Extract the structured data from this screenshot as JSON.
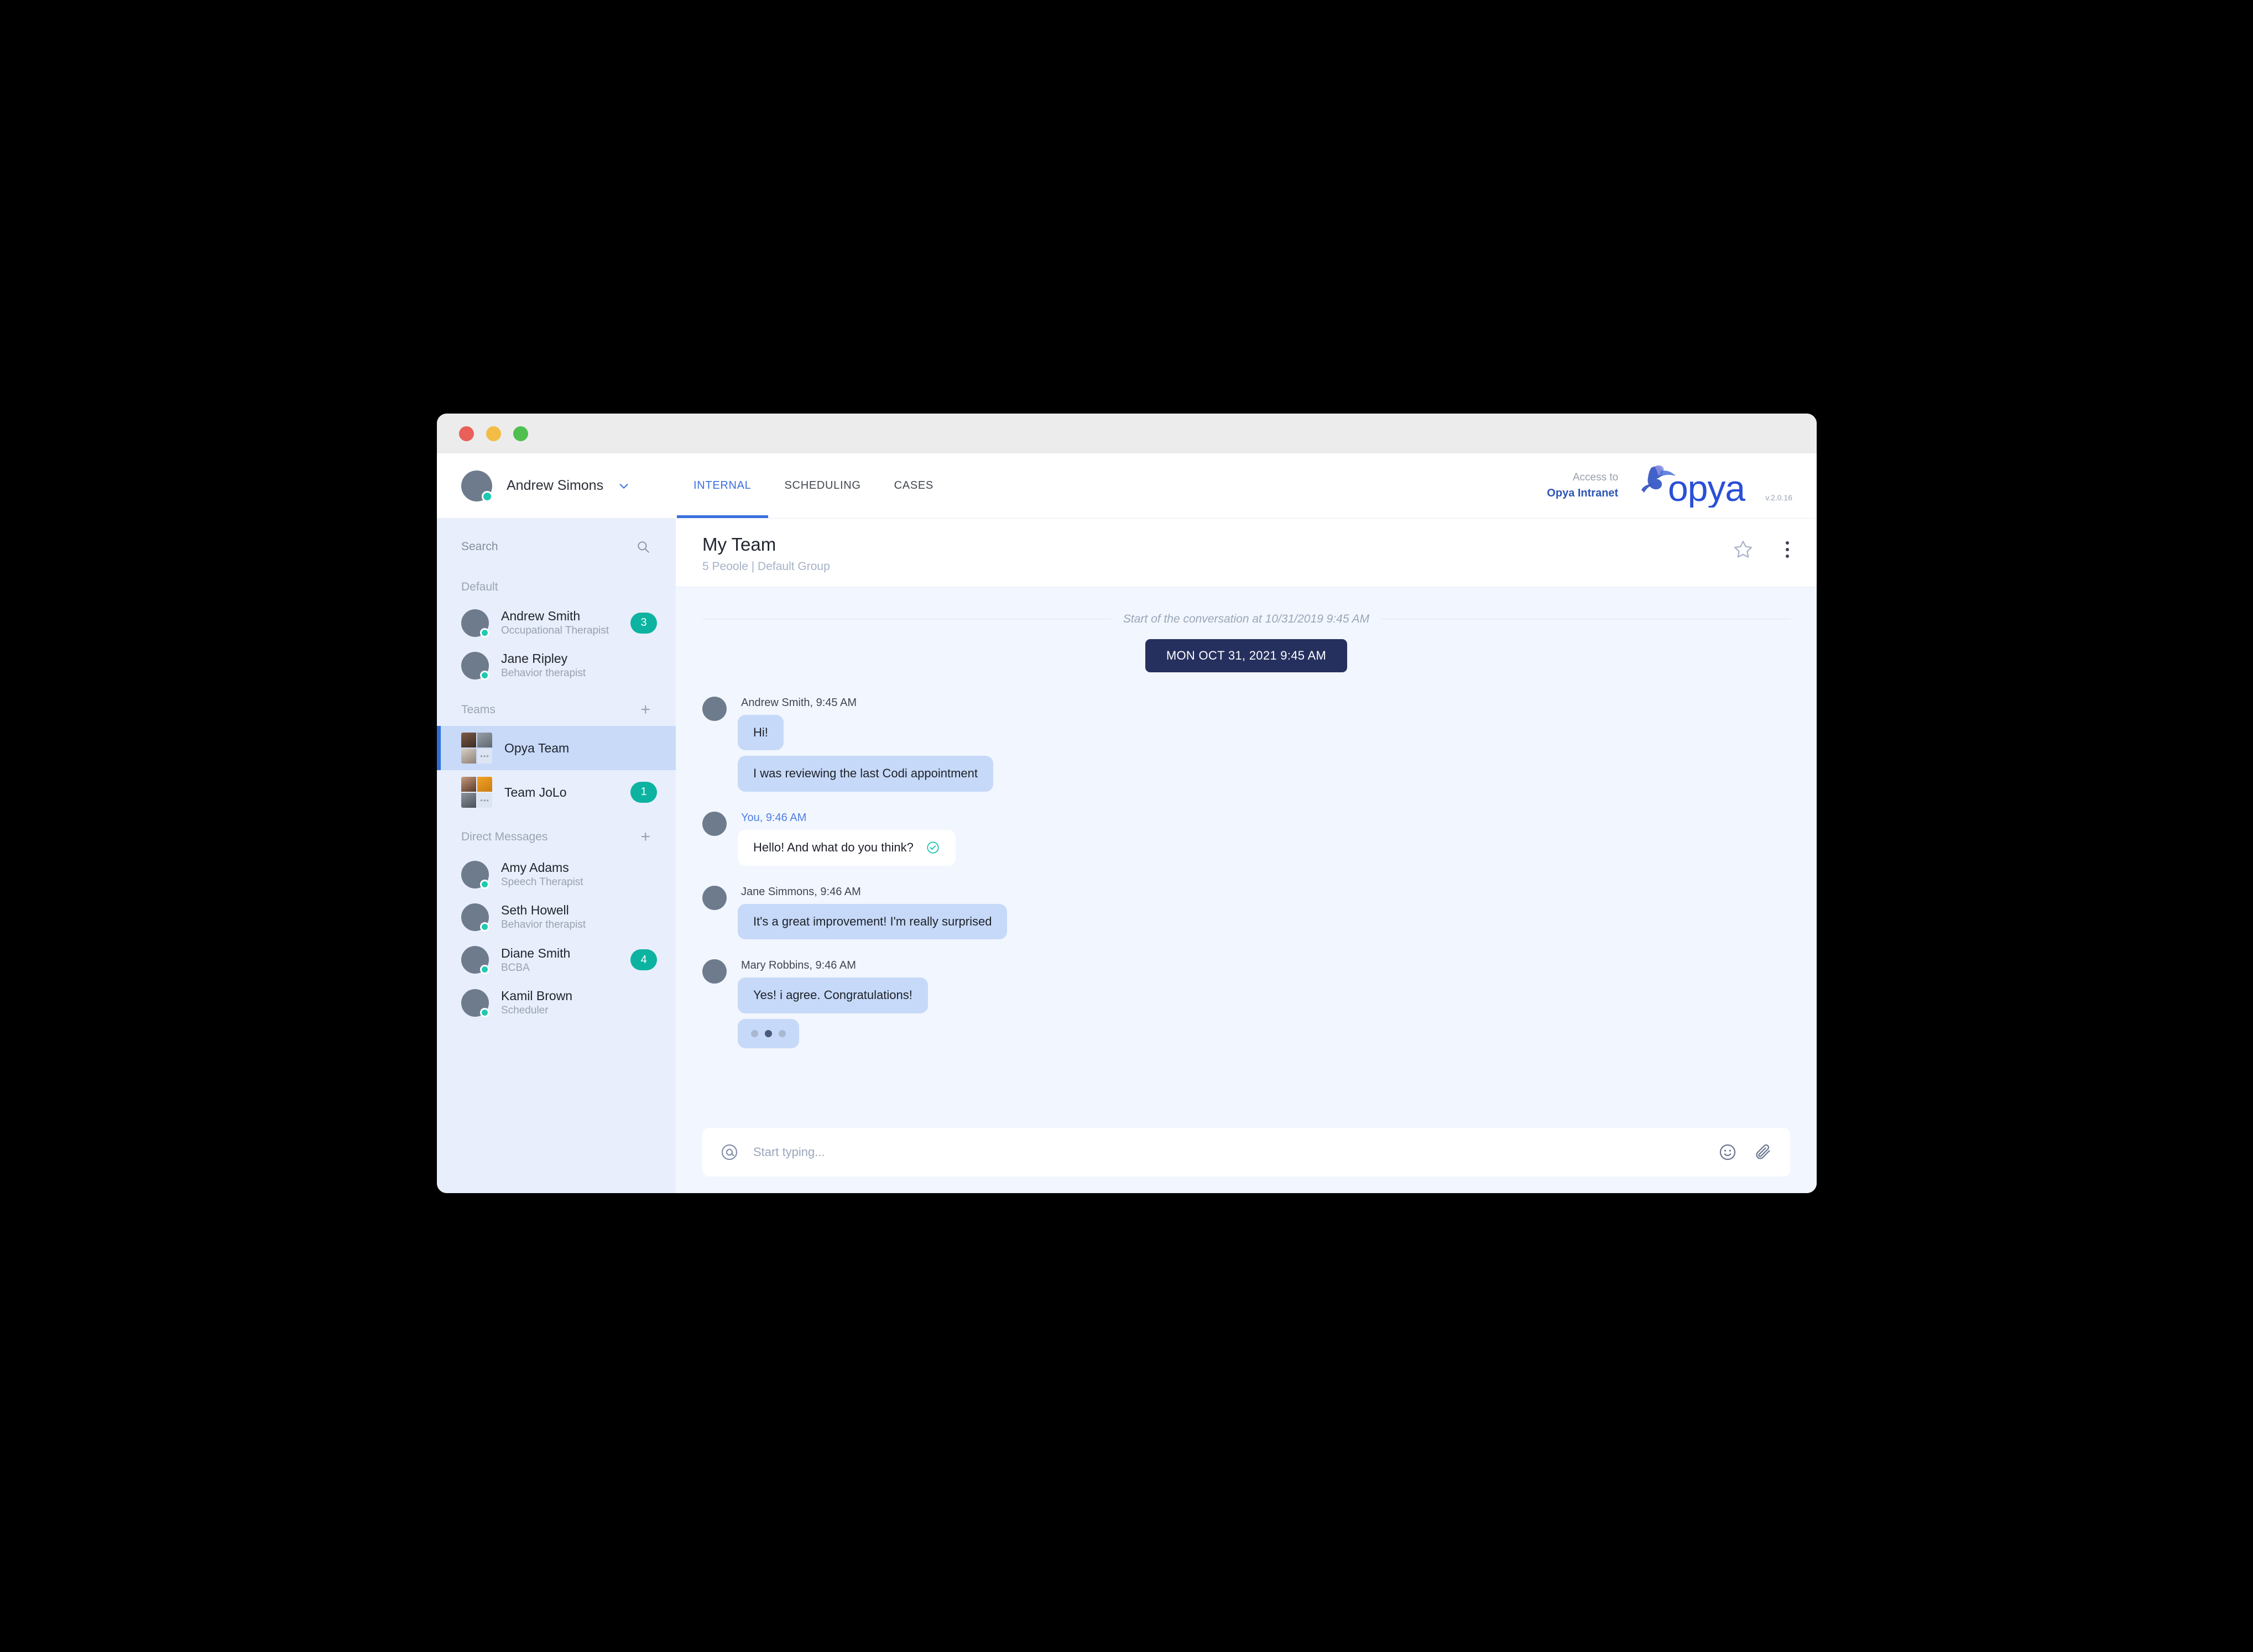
{
  "window": {
    "traffic_lights": [
      "close",
      "minimize",
      "maximize"
    ]
  },
  "topnav": {
    "user_name": "Andrew Simons",
    "tabs": [
      {
        "label": "INTERNAL",
        "active": true
      },
      {
        "label": "SCHEDULING",
        "active": false
      },
      {
        "label": "CASES",
        "active": false
      }
    ],
    "access_line1": "Access to",
    "access_line2": "Opya Intranet",
    "brand": "opya",
    "version": "v.2.0.16"
  },
  "sidebar": {
    "search_placeholder": "Search",
    "search_value": "",
    "sections": [
      {
        "title": "Default",
        "add": false,
        "items": [
          {
            "name": "Andrew Smith",
            "role": "Occupational Therapist",
            "badge": "3",
            "type": "person",
            "online": true
          },
          {
            "name": "Jane Ripley",
            "role": "Behavior therapist",
            "badge": "",
            "type": "person",
            "online": true
          }
        ]
      },
      {
        "title": "Teams",
        "add": true,
        "items": [
          {
            "name": "Opya Team",
            "role": "",
            "badge": "",
            "type": "team",
            "selected": true
          },
          {
            "name": "Team JoLo",
            "role": "",
            "badge": "1",
            "type": "team",
            "selected": false
          }
        ]
      },
      {
        "title": "Direct Messages",
        "add": true,
        "items": [
          {
            "name": "Amy Adams",
            "role": "Speech Therapist",
            "badge": "",
            "type": "person",
            "online": true
          },
          {
            "name": "Seth Howell",
            "role": "Behavior therapist",
            "badge": "",
            "type": "person",
            "online": true
          },
          {
            "name": "Diane Smith",
            "role": "BCBA",
            "badge": "4",
            "type": "person",
            "online": true
          },
          {
            "name": "Kamil Brown",
            "role": "Scheduler",
            "badge": "",
            "type": "person",
            "online": true
          }
        ]
      }
    ]
  },
  "chat": {
    "title": "My Team",
    "subtitle": "5 Peoole | Default Group",
    "star_icon": "star-icon",
    "menu_icon": "kebab-menu-icon",
    "start_text": "Start of the conversation at 10/31/2019 9:45 AM",
    "date_pill": "MON OCT 31, 2021 9:45 AM",
    "messages": [
      {
        "author": "Andrew Smith, 9:45 AM",
        "self": false,
        "bubbles": [
          "Hi!",
          "I was reviewing the last Codi appointment"
        ],
        "read_receipt": false
      },
      {
        "author": "You, 9:46 AM",
        "self": true,
        "bubbles": [
          "Hello! And what do you think?"
        ],
        "read_receipt": true
      },
      {
        "author": "Jane Simmons, 9:46 AM",
        "self": false,
        "bubbles": [
          "It's a great improvement!  I'm really surprised"
        ],
        "read_receipt": false
      },
      {
        "author": "Mary Robbins, 9:46 AM",
        "self": false,
        "bubbles": [
          "Yes! i agree. Congratulations!"
        ],
        "read_receipt": false,
        "typing": true
      }
    ],
    "composer": {
      "mention_icon": "at-mention-icon",
      "placeholder": "Start typing...",
      "value": "",
      "emoji_icon": "emoji-smiley-icon",
      "attach_icon": "paperclip-icon"
    }
  },
  "colors": {
    "accent_blue": "#3b6fe0",
    "badge_teal": "#0cb3a0",
    "sidebar_bg": "#e8eefb",
    "chat_bg": "#f2f6fe",
    "bubble_other": "#c6d9f8",
    "date_pill_bg": "#26305f",
    "online_green": "#1ec9b0",
    "brand_blue": "#2f56b5"
  }
}
